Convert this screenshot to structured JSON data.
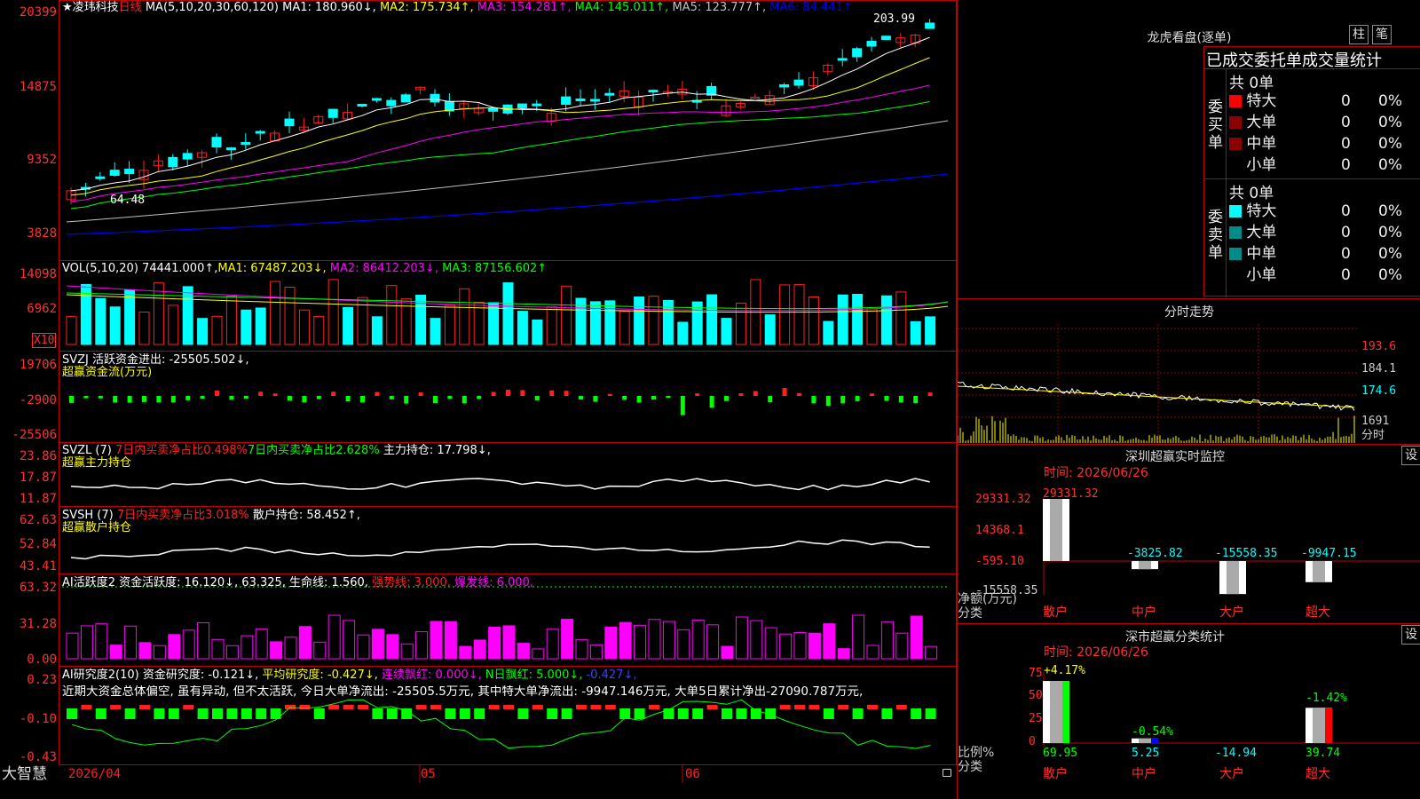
{
  "app": {
    "name": "大智慧",
    "date_label": "2026/04",
    "month_05": "05",
    "month_06": "06"
  },
  "colors": {
    "up": "#ff2020",
    "down": "#00ffff",
    "bg": "#000000",
    "grid": "#8b0000",
    "ma1": "#ffffff",
    "ma2": "#ffff00",
    "ma3": "#ff00ff",
    "ma4": "#00ff00",
    "ma5": "#c0c0c0",
    "ma6": "#0000ff"
  },
  "main": {
    "title_prefix": "★",
    "stock": "凌玮科技",
    "period": "日线",
    "ma_params": "MA(5,10,20,30,60,120)",
    "ma1": "MA1: 180.960↓,",
    "ma2": "MA2: 175.734↑,",
    "ma3": "MA3: 154.281↑,",
    "ma4": "MA4: 145.011↑,",
    "ma5": "MA5: 123.777↑,",
    "ma6": "MA6: 84.441↑",
    "high_label": "203.99",
    "low_label": "64.48",
    "axis": [
      "20399",
      "14875",
      "9352",
      "3828"
    ]
  },
  "vol": {
    "params": "VOL(5,10,20)",
    "value": "74441.000↑,",
    "ma1": "MA1: 67487.203↓,",
    "ma2": "MA2: 86412.203↓,",
    "ma3": "MA3: 87156.602↑",
    "axis": [
      "14098",
      "6962"
    ],
    "multiplier": "X10"
  },
  "svzj": {
    "name": "SVZJ",
    "label": "活跃资金进出: -25505.502↓,",
    "subtitle": "超赢资金流(万元)",
    "axis": [
      "19706",
      "-2900",
      "-25506"
    ]
  },
  "svzl": {
    "name": "SVZL (7)",
    "t1": "7日内买卖净占比0.498%",
    "t2": "7日内买卖净占比2.628%",
    "t3": "主力持仓: 17.798↓,",
    "subtitle": "超赢主力持仓",
    "axis": [
      "23.86",
      "17.87",
      "11.87"
    ]
  },
  "svsh": {
    "name": "SVSH (7)",
    "t1": "7日内买卖净占比3.018%",
    "t2": "散户持仓: 58.452↑,",
    "subtitle": "超赢散户持仓",
    "axis": [
      "62.63",
      "52.84",
      "43.41"
    ]
  },
  "ai1": {
    "name": "AI活跃度2",
    "t1": "资金活跃度: 16.120↓, 63.325, 生命线: 1.560,",
    "t2": "强势线: 3.000,",
    "t3": "爆发线: 6.000,",
    "axis": [
      "63.32",
      "31.28",
      "0.00"
    ]
  },
  "ai2": {
    "name": "AI研究度2(10)",
    "t1": "资金研究度: -0.121↓,",
    "t2": "平均研究度: -0.427↓,",
    "t3": "连续飘红: 0.000↓,",
    "t4": "N日飘红: 5.000↓,",
    "t5": "-0.427↓,",
    "comment": "近期大资金总体偏空, 虽有异动, 但不太活跃, 今日大单净流出: -25505.5万元, 其中特大单净流出: -9947.146万元, 大单5日累计净出-27090.787万元,",
    "axis": [
      "0.23",
      "-0.10",
      "-0.43"
    ]
  },
  "lhb": {
    "title": "龙虎看盘(逐单)",
    "btn1": "柱",
    "btn2": "笔",
    "header": "已成交委托单成交量统计",
    "buy_label": "委买单",
    "sell_label": "委卖单",
    "buy_total": "共 0单",
    "sell_total": "共 0单",
    "rows": [
      "特大",
      "大单",
      "中单",
      "小单"
    ],
    "count": "0",
    "pct": "0%"
  },
  "fenshi": {
    "title": "分时走势",
    "axis": [
      "193.6",
      "184.1",
      "174.6",
      "1691",
      "分时"
    ]
  },
  "sz_monitor": {
    "title": "深圳超赢实时监控",
    "btn": "设",
    "time": "时间: 2026/06/26",
    "axis": [
      "29331.32",
      "14368.1",
      "-595.10",
      "-15558.35"
    ],
    "ylabel": "净额(万元)",
    "xlabel": "分类",
    "values": [
      "29331.32",
      "-3825.82",
      "-15558.35",
      "-9947.15"
    ],
    "cats": [
      "散户",
      "中户",
      "大户",
      "超大"
    ]
  },
  "sz_stats": {
    "title": "深市超赢分类统计",
    "btn": "设",
    "time": "时间: 2026/06/26",
    "axis": [
      "75",
      "50",
      "25",
      "0"
    ],
    "ylabel": "比例%",
    "xlabel": "分类",
    "top_labels": [
      "+4.17%",
      "-0.54%",
      "-1.42%"
    ],
    "values": [
      "69.95",
      "5.25",
      "-14.94",
      "39.74"
    ],
    "cats": [
      "散户",
      "中户",
      "大户",
      "超大"
    ]
  }
}
